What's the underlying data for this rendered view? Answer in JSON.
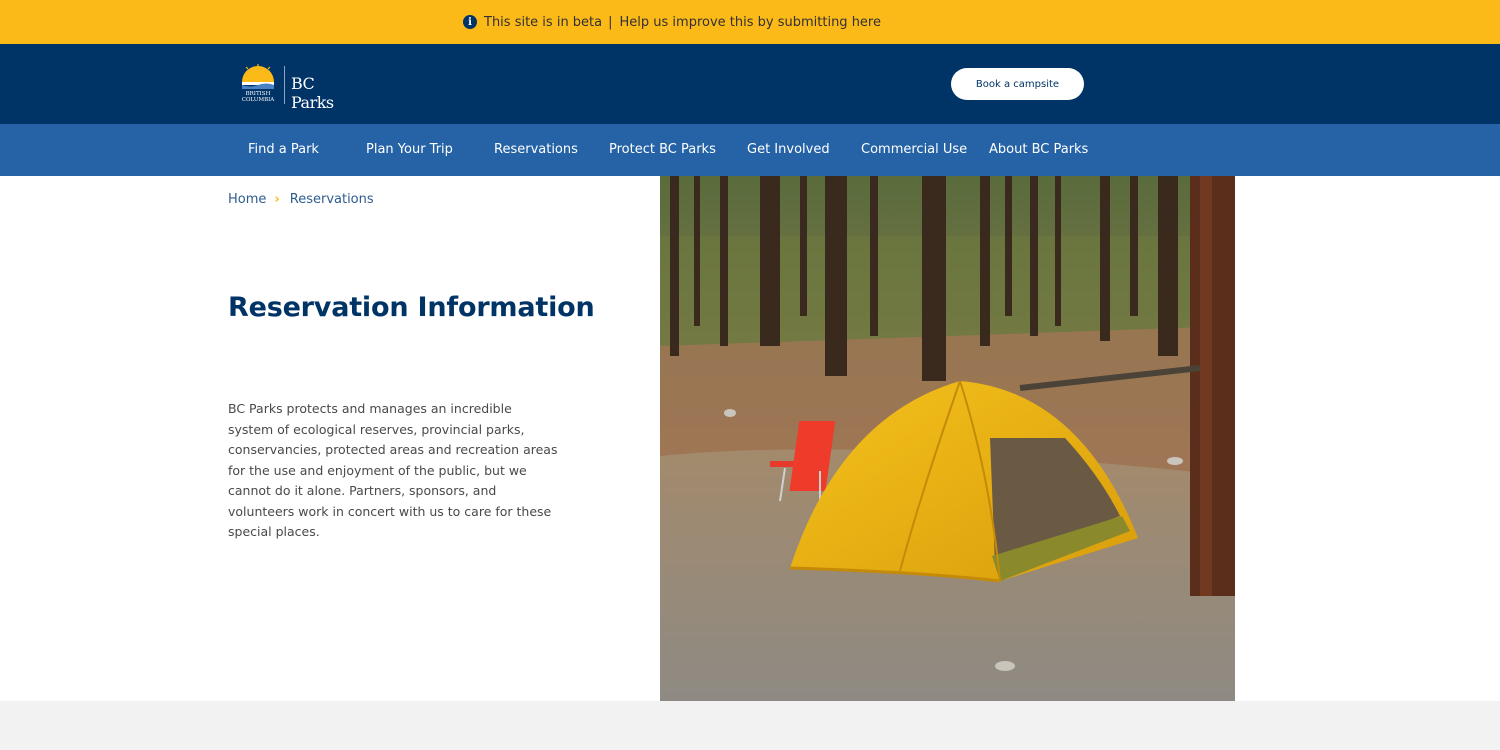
{
  "beta_banner": {
    "message": "This site is in beta",
    "separator": "|",
    "feedback_link": "Help us improve this by submitting here",
    "icon": "info-circle-icon"
  },
  "header": {
    "logo_text": "BC Parks",
    "logo_sub_line1": "BRITISH",
    "logo_sub_line2": "COLUMBIA",
    "book_button": "Book a campsite"
  },
  "nav": {
    "items": [
      {
        "label": "Find a Park"
      },
      {
        "label": "Plan Your Trip"
      },
      {
        "label": "Reservations"
      },
      {
        "label": "Protect BC Parks"
      },
      {
        "label": "Get Involved"
      },
      {
        "label": "Commercial Use"
      },
      {
        "label": "About BC Parks"
      }
    ]
  },
  "breadcrumb": {
    "home": "Home",
    "current": "Reservations",
    "separator_icon": "chevron-right-icon"
  },
  "main": {
    "title": "Reservation Information",
    "intro": "BC Parks protects and manages an incredible system of ecological reserves, provincial parks, conservancies, protected areas and recreation areas for the use and enjoyment of the public, but we cannot do it alone. Partners, sponsors, and volunteers work in concert with us to care for these special places."
  },
  "colors": {
    "beta_yellow": "#fcba19",
    "header_navy": "#003366",
    "nav_blue": "#2563a6",
    "footer_gray": "#f2f2f2"
  }
}
